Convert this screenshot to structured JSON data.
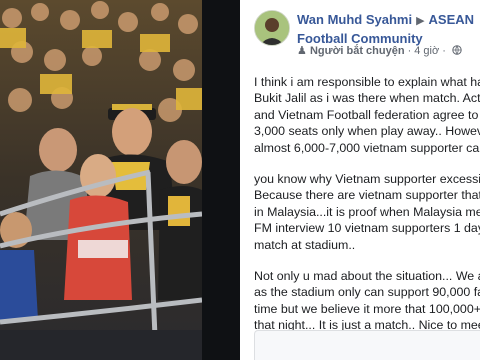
{
  "photo": {
    "description_icon": "crowd-photo"
  },
  "post": {
    "author": "Wan Muhd Syahmi",
    "separator_icon": "triangle-right",
    "group": "ASEAN Football Community",
    "shared_label": "Người bắt chuyện",
    "time": "4 giờ",
    "privacy_icon": "globe-icon",
    "paragraphs": [
      "I think i am responsible to explain what ha\nBukit Jalil as i was there when match. Actu\nand Vietnam Football federation agree to c\n3,000 seats only when play away.. Howeve\nalmost 6,000-7,000 vietnam supporter ca",
      "you know why Vietnam supporter excessiv\nBecause there are vietnam supporter that\nin Malaysia...it is proof when Malaysia med\nFM interview 10 vietnam supporters 1 day\nmatch at stadium..",
      "Not only u mad about the situation... We a\nas the stadium only can support 90,000 fa\ntime but we believe it more that 100,000+\nthat night... It is just a match.. Nice to mee\nVietnam fans"
    ]
  },
  "colors": {
    "link": "#385898",
    "meta": "#616770",
    "text": "#1c1e21"
  }
}
